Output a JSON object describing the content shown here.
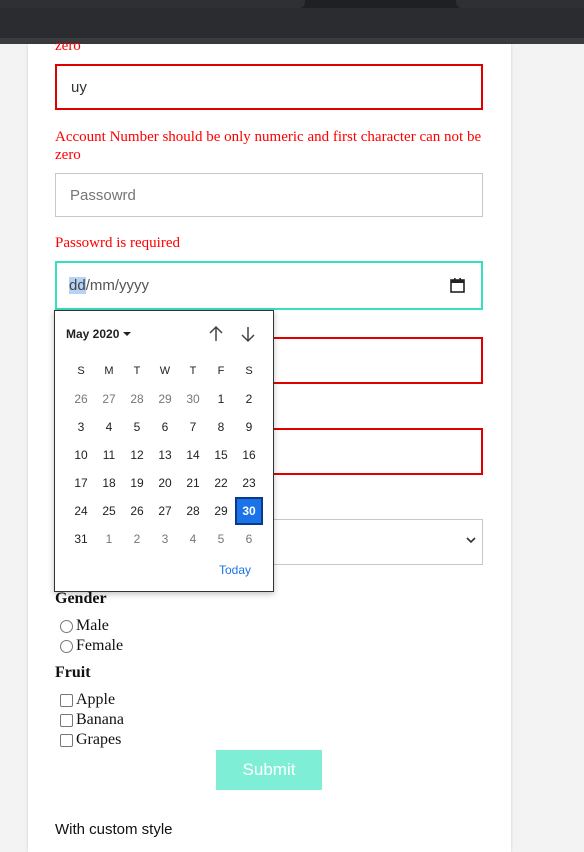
{
  "form": {
    "top_error_tail": "zero",
    "account_input_value": "uy",
    "account_error": "Account Number should be only numeric and first character can not be zero",
    "password_placeholder": "Passowrd",
    "password_error": "Passowrd is required",
    "date_placeholder_day": "dd",
    "date_placeholder_rest": "/mm/yyyy"
  },
  "datepicker": {
    "month_label": "May 2020",
    "weekday_headers": [
      "S",
      "M",
      "T",
      "W",
      "T",
      "F",
      "S"
    ],
    "weeks": [
      [
        "26",
        "27",
        "28",
        "29",
        "30",
        "1",
        "2"
      ],
      [
        "3",
        "4",
        "5",
        "6",
        "7",
        "8",
        "9"
      ],
      [
        "10",
        "11",
        "12",
        "13",
        "14",
        "15",
        "16"
      ],
      [
        "17",
        "18",
        "19",
        "20",
        "21",
        "22",
        "23"
      ],
      [
        "24",
        "25",
        "26",
        "27",
        "28",
        "29",
        "30"
      ],
      [
        "31",
        "1",
        "2",
        "3",
        "4",
        "5",
        "6"
      ]
    ],
    "selected_day": "30",
    "today_label": "Today"
  },
  "gender": {
    "title": "Gender",
    "options": [
      "Male",
      "Female"
    ]
  },
  "fruit": {
    "title": "Fruit",
    "options": [
      "Apple",
      "Banana",
      "Grapes"
    ]
  },
  "submit_label": "Submit",
  "footer_text": "With custom style",
  "colors": {
    "error": "#ff0000",
    "focus": "#35e0bd",
    "submit": "#7eefd6",
    "selected_day": "#1a73e8"
  }
}
